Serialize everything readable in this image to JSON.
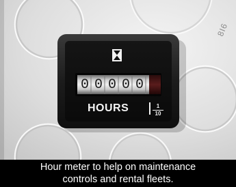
{
  "photo": {
    "subject": "hour meter",
    "meter": {
      "digits": [
        "0",
        "0",
        "0",
        "0",
        "0"
      ],
      "unit_label": "HOURS",
      "fraction_numerator": "1",
      "fraction_denominator": "10"
    },
    "background_embossed_text": "8I6"
  },
  "caption": {
    "line1": "Hour meter to help on maintenance",
    "line2": "controls and rental fleets."
  }
}
